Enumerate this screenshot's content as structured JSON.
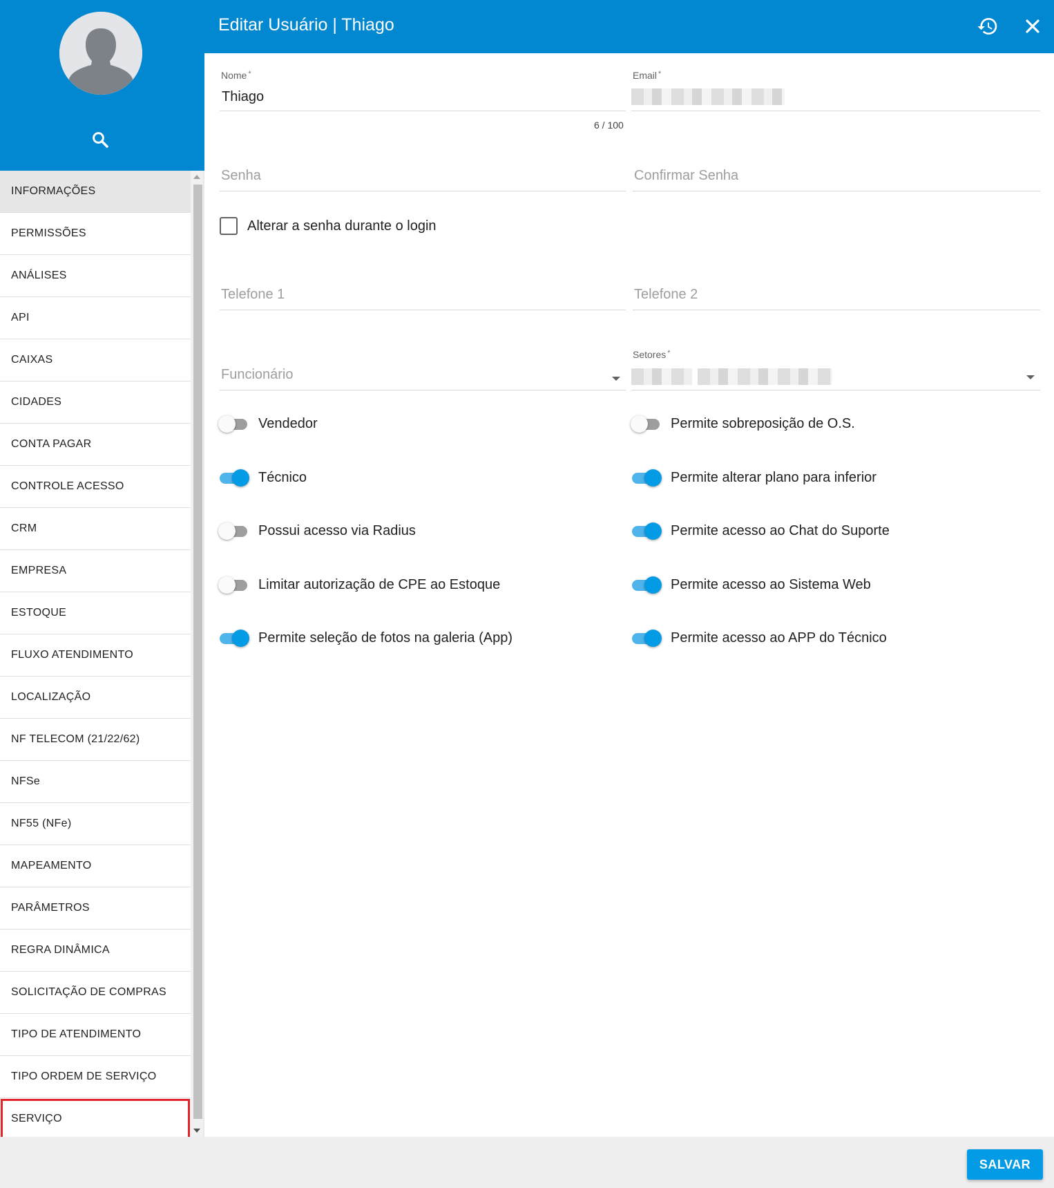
{
  "header": {
    "title": "Editar Usuário | Thiago",
    "history_icon": "history-icon",
    "close_icon": "close-icon"
  },
  "sidebar": {
    "avatar_icon": "user-avatar-icon",
    "search_icon": "search-icon",
    "items": [
      {
        "label": "INFORMAÇÕES",
        "active": true
      },
      {
        "label": "PERMISSÕES"
      },
      {
        "label": "ANÁLISES"
      },
      {
        "label": "API"
      },
      {
        "label": "CAIXAS"
      },
      {
        "label": "CIDADES"
      },
      {
        "label": "CONTA PAGAR"
      },
      {
        "label": "CONTROLE ACESSO"
      },
      {
        "label": "CRM"
      },
      {
        "label": "EMPRESA"
      },
      {
        "label": "ESTOQUE"
      },
      {
        "label": "FLUXO ATENDIMENTO"
      },
      {
        "label": "LOCALIZAÇÃO"
      },
      {
        "label": "NF TELECOM (21/22/62)"
      },
      {
        "label": "NFSe"
      },
      {
        "label": "NF55 (NFe)"
      },
      {
        "label": "MAPEAMENTO"
      },
      {
        "label": "PARÂMETROS"
      },
      {
        "label": "REGRA DINÂMICA"
      },
      {
        "label": "SOLICITAÇÃO DE COMPRAS"
      },
      {
        "label": "TIPO DE ATENDIMENTO"
      },
      {
        "label": "TIPO ORDEM DE SERVIÇO"
      },
      {
        "label": "SERVIÇO",
        "highlighted": true
      }
    ]
  },
  "form": {
    "nome": {
      "label": "Nome",
      "required_mark": "*",
      "value": "Thiago",
      "counter": "6 / 100"
    },
    "email": {
      "label": "Email",
      "required_mark": "*"
    },
    "senha": {
      "placeholder": "Senha"
    },
    "confirmar_senha": {
      "placeholder": "Confirmar Senha"
    },
    "alterar_senha": {
      "label": "Alterar a senha durante o login",
      "checked": false
    },
    "telefone1": {
      "placeholder": "Telefone 1"
    },
    "telefone2": {
      "placeholder": "Telefone 2"
    },
    "funcionario": {
      "placeholder": "Funcionário"
    },
    "setores": {
      "label": "Setores",
      "required_mark": "*"
    },
    "toggles_left": [
      {
        "label": "Vendedor",
        "on": false
      },
      {
        "label": "Técnico",
        "on": true
      },
      {
        "label": "Possui acesso via Radius",
        "on": false
      },
      {
        "label": "Limitar autorização de CPE ao Estoque",
        "on": false
      },
      {
        "label": "Permite seleção de fotos na galeria (App)",
        "on": true
      }
    ],
    "toggles_right": [
      {
        "label": "Permite sobreposição de O.S.",
        "on": false
      },
      {
        "label": "Permite alterar plano para inferior",
        "on": true
      },
      {
        "label": "Permite acesso ao Chat do Suporte",
        "on": true
      },
      {
        "label": "Permite acesso ao Sistema Web",
        "on": true
      },
      {
        "label": "Permite acesso ao APP do Técnico",
        "on": true
      }
    ]
  },
  "footer": {
    "save_label": "SALVAR"
  },
  "colors": {
    "primary": "#0288d1",
    "accent": "#039be5",
    "highlight_border": "#e5232a"
  }
}
